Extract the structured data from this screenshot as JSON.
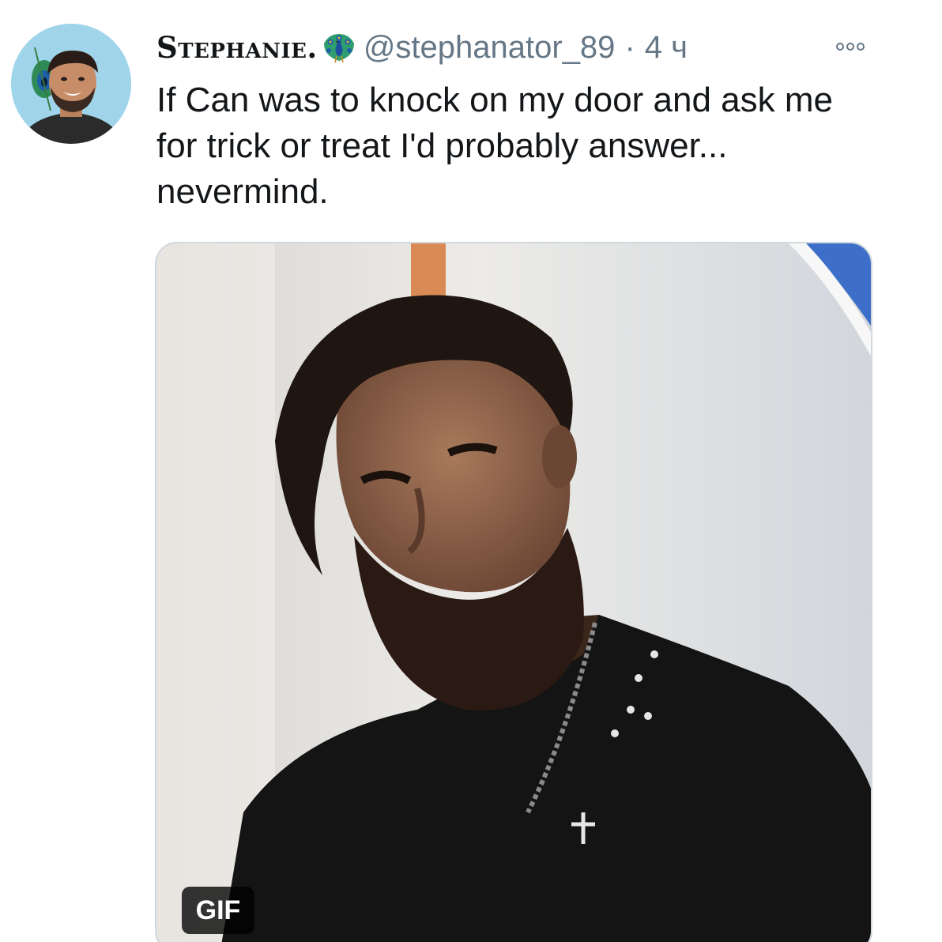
{
  "tweet": {
    "display_name": "Stephanie.",
    "handle": "@stephanator_89",
    "separator": "·",
    "time": "4 ч",
    "text": "If Can was to knock on my door and ask me\nfor trick or treat I'd probably answer...\nnevermind.",
    "media": {
      "badge": "GIF"
    }
  },
  "icons": {
    "verified_emoji": "peacock-icon",
    "more": "more-options-icon"
  },
  "colors": {
    "text": "#14171a",
    "secondary": "#657786",
    "media_border": "#cfd9de",
    "avatar_bg": "#9fd4ea"
  }
}
